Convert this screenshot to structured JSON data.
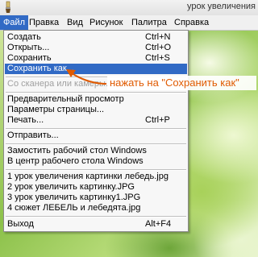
{
  "window": {
    "title": "урок увеличения"
  },
  "menubar": [
    {
      "label": "Файл"
    },
    {
      "label": "Правка"
    },
    {
      "label": "Вид"
    },
    {
      "label": "Рисунок"
    },
    {
      "label": "Палитра"
    },
    {
      "label": "Справка"
    }
  ],
  "file_menu": {
    "items": [
      {
        "label": "Создать",
        "shortcut": "Ctrl+N"
      },
      {
        "label": "Открыть...",
        "shortcut": "Ctrl+O"
      },
      {
        "label": "Сохранить",
        "shortcut": "Ctrl+S"
      },
      {
        "label": "Сохранить как..."
      },
      {
        "label": "Со сканера или камеры..."
      },
      {
        "label": "Предварительный просмотр"
      },
      {
        "label": "Параметры страницы..."
      },
      {
        "label": "Печать...",
        "shortcut": "Ctrl+P"
      },
      {
        "label": "Отправить..."
      },
      {
        "label": "Замостить рабочий стол Windows"
      },
      {
        "label": "В центр рабочего стола Windows"
      },
      {
        "label": "1 урок увеличения картинки лебедь.jpg"
      },
      {
        "label": "2 урок увеличить картинку.JPG"
      },
      {
        "label": "3 урок увеличить картинку1.JPG"
      },
      {
        "label": "4 сюжет ЛЕБЕЛЬ и лебедята.jpg"
      },
      {
        "label": "Выход",
        "shortcut": "Alt+F4"
      }
    ],
    "highlighted_item": "Сохранить как...",
    "disabled_item": "Со сканера или камеры..."
  },
  "annotation": {
    "text": "нажать на \"Сохранить как\"",
    "color": "#e05a00"
  },
  "colors": {
    "highlight": "#316ac5",
    "menu_bg": "#f7f7f7"
  },
  "icons": {
    "app": "paint-app-icon"
  }
}
